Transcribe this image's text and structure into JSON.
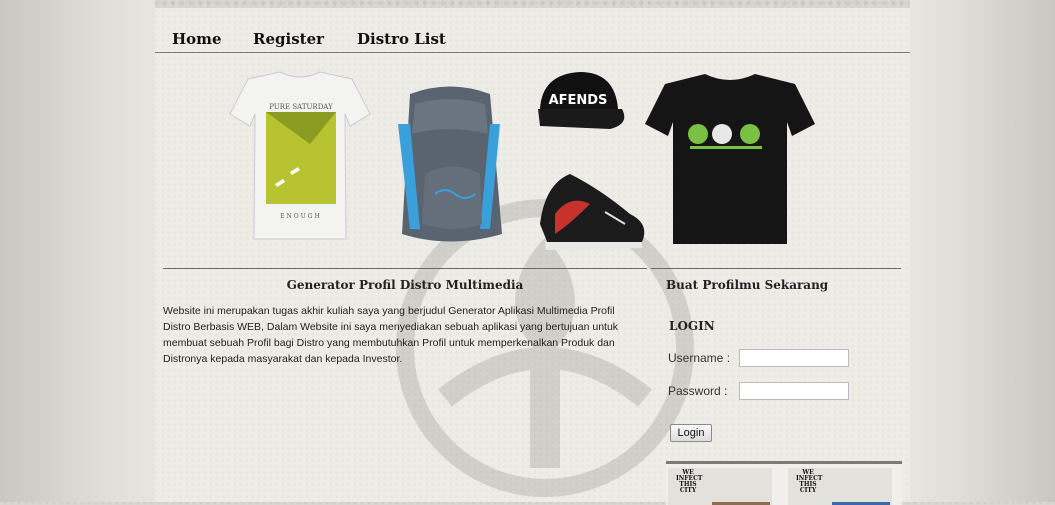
{
  "nav": {
    "items": [
      {
        "label": "Home"
      },
      {
        "label": "Register"
      },
      {
        "label": "Distro List"
      }
    ]
  },
  "banner": {
    "tshirt1_top": "PURE SATURDAY",
    "tshirt1_bottom": "ENOUGH",
    "cap_text": "AFENDS"
  },
  "main": {
    "title": "Generator Profil Distro Multimedia",
    "description": "Website ini merupakan tugas akhir kuliah saya yang berjudul Generator Aplikasi Multimedia Profil Distro Berbasis WEB, Dalam Website ini saya menyediakan sebuah aplikasi yang bertujuan untuk membuat sebuah Profil bagi Distro yang membutuhkan Profil untuk memperkenalkan Produk dan Distronya kepada masyarakat dan kepada Investor."
  },
  "sidebar": {
    "title": "Buat Profilmu Sekarang",
    "login_heading": "LOGIN",
    "username_label": "Username :",
    "password_label": "Password  :",
    "username_value": "",
    "password_value": "",
    "login_button": "Login"
  },
  "gallery": {
    "items": [
      {
        "label": "WE INFECT THIS CITY"
      },
      {
        "label": "WE INFECT THIS CITY"
      }
    ]
  },
  "colors": {
    "background": "#d9d7d1",
    "content": "#eeece6",
    "divider": "#6d6b66"
  }
}
